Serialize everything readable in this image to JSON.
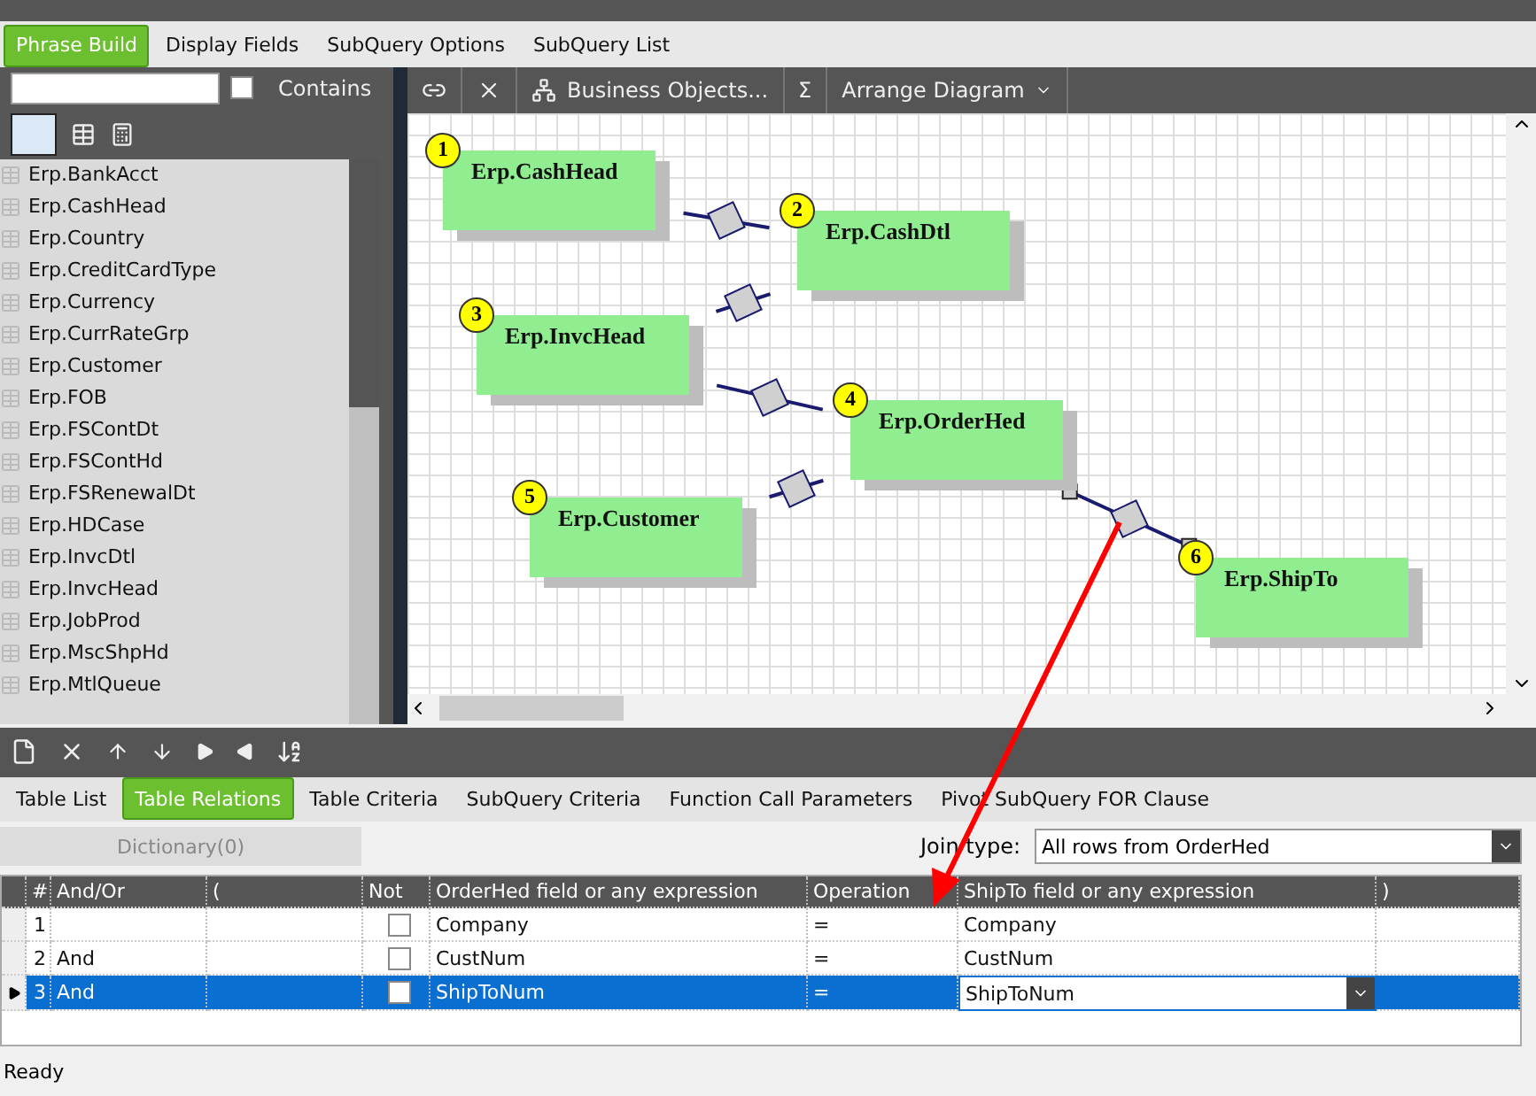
{
  "top_tabs": [
    {
      "label": "Phrase Build",
      "selected": true
    },
    {
      "label": "Display Fields",
      "selected": false
    },
    {
      "label": "SubQuery Options",
      "selected": false
    },
    {
      "label": "SubQuery List",
      "selected": false
    }
  ],
  "table_search": {
    "label": "Contains",
    "checked": false
  },
  "tables": [
    "Erp.BankAcct",
    "Erp.CashHead",
    "Erp.Country",
    "Erp.CreditCardType",
    "Erp.Currency",
    "Erp.CurrRateGrp",
    "Erp.Customer",
    "Erp.FOB",
    "Erp.FSContDt",
    "Erp.FSContHd",
    "Erp.FSRenewalDt",
    "Erp.HDCase",
    "Erp.InvcDtl",
    "Erp.InvcHead",
    "Erp.JobProd",
    "Erp.MscShpHd",
    "Erp.MtlQueue"
  ],
  "diagram_toolbar": {
    "business_objects": "Business Objects...",
    "sum": "Σ",
    "arrange": "Arrange Diagram"
  },
  "diagram": {
    "nodes": [
      {
        "number": "1",
        "name": "Erp.CashHead"
      },
      {
        "number": "2",
        "name": "Erp.CashDtl"
      },
      {
        "number": "3",
        "name": "Erp.InvcHead"
      },
      {
        "number": "4",
        "name": "Erp.OrderHed"
      },
      {
        "number": "5",
        "name": "Erp.Customer"
      },
      {
        "number": "6",
        "name": "Erp.ShipTo"
      }
    ],
    "links": [
      {
        "selected": false
      },
      {
        "selected": false
      },
      {
        "selected": false
      },
      {
        "selected": false
      },
      {
        "selected": true
      }
    ]
  },
  "bottom_tabs": [
    {
      "label": "Table List",
      "selected": false
    },
    {
      "label": "Table Relations",
      "selected": true
    },
    {
      "label": "Table Criteria",
      "selected": false
    },
    {
      "label": "SubQuery Criteria",
      "selected": false
    },
    {
      "label": "Function Call Parameters",
      "selected": false
    },
    {
      "label": "Pivot SubQuery FOR Clause",
      "selected": false
    }
  ],
  "dictionary_button": {
    "label": "Dictionary(0)",
    "disabled": true
  },
  "join_type": {
    "label": "Join type:",
    "value": "All rows from OrderHed"
  },
  "relations": {
    "columns": [
      "#",
      "And/Or",
      "(",
      "Not",
      "OrderHed field or any expression",
      "Operation",
      "ShipTo field or any expression",
      ")"
    ],
    "rows": [
      {
        "number": "1",
        "and_or": "",
        "not": false,
        "left": "Company",
        "operation": "=",
        "right": "Company",
        "selected": false
      },
      {
        "number": "2",
        "and_or": "And",
        "not": false,
        "left": "CustNum",
        "operation": "=",
        "right": "CustNum",
        "selected": false
      },
      {
        "number": "3",
        "and_or": "And",
        "not": false,
        "left": "ShipToNum",
        "operation": "=",
        "right": "ShipToNum",
        "selected": true
      }
    ]
  },
  "status_bar": "Ready"
}
